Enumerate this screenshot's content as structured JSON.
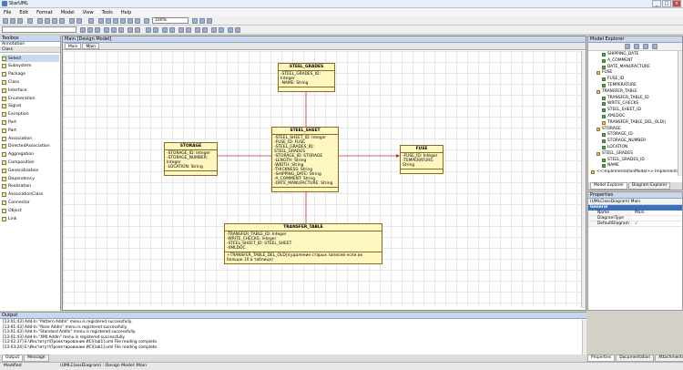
{
  "window": {
    "title": "StarUML"
  },
  "menu": [
    "File",
    "Edit",
    "Format",
    "Model",
    "View",
    "Tools",
    "Help"
  ],
  "toolbar": {
    "zoom": "100%"
  },
  "toolbox": {
    "title": "Toolbox",
    "section": "Annotation",
    "category": "Class",
    "items": [
      "Select",
      "Subsystem",
      "Package",
      "Class",
      "Interface",
      "Enumeration",
      "Signal",
      "Exception",
      "Port",
      "Part",
      "Association",
      "DirectedAssociation",
      "Aggregation",
      "Composition",
      "Generalization",
      "Dependency",
      "Realization",
      "AssociationClass",
      "Connector",
      "Object",
      "Link"
    ]
  },
  "diagram": {
    "header": "Main [Design Model]",
    "tabs": [
      "Main",
      "Main"
    ],
    "classes": {
      "steel_grades": {
        "name": "STEEL_GRADES",
        "attrs": [
          "-STEEL_GRADES_ID: Integer",
          "-NAME: String"
        ]
      },
      "steel_sheet": {
        "name": "STEEL_SHEET",
        "attrs": [
          "-STEEL_SHEET_ID: Integer",
          "-FUSE_ID: FUSE",
          "-STEEL_GRADES_ID: STEEL_GRADES",
          "-STORAGE_ID: STORAGE",
          "-LENGTH: String",
          "-WIDTH: String",
          "-THICKNESS: String",
          "-SHIPPING_DATE: String",
          "-A_COMMENT: String",
          "-DATE_MANUFACTURE: String"
        ]
      },
      "storage": {
        "name": "STORAGE",
        "attrs": [
          "-STORAGE_ID: Integer",
          "-STORAGE_NUMBER: Integer",
          "-LOCATION: String"
        ]
      },
      "fuse": {
        "name": "FUSE",
        "attrs": [
          "-FUSE_ID: Integer",
          "-TEMPERATURE: String"
        ]
      },
      "transfer_table": {
        "name": "TRANSFER_TABLE",
        "attrs": [
          "-TRANSFER_TABLE_ID: Integer",
          "-WRITE_CHECKS: Integer",
          "-STEEL_SHEET_ID: STEEL_SHEET",
          "-XMLDOC"
        ],
        "ops": [
          "+TRANSFER_TABLE_DEL_OLD()(удаление старых записей если их больше 10 в таблице)"
        ]
      }
    }
  },
  "explorer": {
    "title": "Model Explorer",
    "items": [
      {
        "label": "SHIPPING_DATE",
        "indent": 2,
        "kind": "attr"
      },
      {
        "label": "A_COMMENT",
        "indent": 2,
        "kind": "attr"
      },
      {
        "label": "DATE_MANUFACTURE",
        "indent": 2,
        "kind": "attr"
      },
      {
        "label": "FUSE",
        "indent": 1,
        "kind": "class"
      },
      {
        "label": "FUSE_ID",
        "indent": 2,
        "kind": "attr"
      },
      {
        "label": "TEMPERATURE",
        "indent": 2,
        "kind": "attr"
      },
      {
        "label": "TRANSFER_TABLE",
        "indent": 1,
        "kind": "class"
      },
      {
        "label": "TRANSFER_TABLE_ID",
        "indent": 2,
        "kind": "attr"
      },
      {
        "label": "WRITE_CHECKS",
        "indent": 2,
        "kind": "attr"
      },
      {
        "label": "STEEL_SHEET_ID",
        "indent": 2,
        "kind": "attr"
      },
      {
        "label": "XMLDOC",
        "indent": 2,
        "kind": "attr"
      },
      {
        "label": "TRANSFER_TABLE_DEL_OLD()",
        "indent": 2,
        "kind": "op"
      },
      {
        "label": "STORAGE",
        "indent": 1,
        "kind": "class"
      },
      {
        "label": "STORAGE_ID",
        "indent": 2,
        "kind": "attr"
      },
      {
        "label": "STORAGE_NUMBER",
        "indent": 2,
        "kind": "attr"
      },
      {
        "label": "LOCATION",
        "indent": 2,
        "kind": "attr"
      },
      {
        "label": "STEEL_GRADES",
        "indent": 1,
        "kind": "class"
      },
      {
        "label": "STEEL_GRADES_ID",
        "indent": 2,
        "kind": "attr"
      },
      {
        "label": "NAME",
        "indent": 2,
        "kind": "attr"
      },
      {
        "label": "<<implementationModel>> Implementation Mod",
        "indent": 0,
        "kind": "class"
      }
    ],
    "tabs": [
      "Model Explorer",
      "Diagram Explorer"
    ]
  },
  "properties": {
    "title": "Properties",
    "selected": "(UMLClassDiagram) Main",
    "section": "General",
    "rows": [
      {
        "key": "Name",
        "value": "Main"
      },
      {
        "key": "DiagramType",
        "value": ""
      },
      {
        "key": "DefaultDiagram",
        "value": "✓"
      }
    ]
  },
  "output": {
    "title": "Output",
    "lines": [
      "[13:01:43]  Add-In \"Pattern AddIn\" menu is registered successfully.",
      "[13:01:43]  Add-In \"Rose AddIn\" menu is registered successfully.",
      "[13:01:43]  Add-In \"Standard AddIn\" menu is registered successfully.",
      "[13:01:43]  Add-In \"XMI AddIn\" menu is registered successfully.",
      "[13:02:37]  E:\\Институт\\Проектирование ИС\\[lab1].uml File reading complete.",
      "[13:03:24]  E:\\Институт\\Проектирование ИС\\[lab1].uml File reading complete."
    ],
    "tabs": [
      "Output",
      "Message"
    ]
  },
  "bottom_right_tabs": [
    "Properties",
    "Documentation",
    "Attachments"
  ],
  "status": {
    "state": "Modified",
    "path": "(UMLClassDiagram) ::Design Model::Main"
  }
}
